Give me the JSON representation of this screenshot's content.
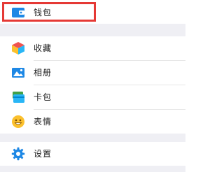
{
  "menu": {
    "items": [
      {
        "label": "钱包",
        "icon": "wallet-icon"
      },
      {
        "label": "收藏",
        "icon": "favorites-cube-icon"
      },
      {
        "label": "相册",
        "icon": "album-icon"
      },
      {
        "label": "卡包",
        "icon": "card-bag-icon"
      },
      {
        "label": "表情",
        "icon": "emoji-icon"
      },
      {
        "label": "设置",
        "icon": "settings-gear-icon"
      }
    ]
  },
  "colors": {
    "highlight": "#e53935",
    "separator": "#efeff4",
    "accent_blue": "#1e88e5"
  }
}
